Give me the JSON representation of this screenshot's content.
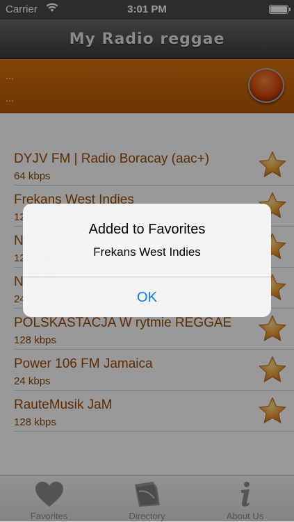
{
  "status_bar": {
    "carrier": "Carrier",
    "time": "3:01 PM"
  },
  "nav": {
    "title": "My Radio reggae"
  },
  "player": {
    "line1": "...",
    "line2": "..."
  },
  "stations": [
    {
      "name": "DYJV FM | Radio Boracay (aac+)",
      "bitrate": "64 kbps"
    },
    {
      "name": "Frekans West Indies",
      "bitrate": "128 kbps"
    },
    {
      "name": "NRJ",
      "bitrate": "128 kbps"
    },
    {
      "name": "NRJ Reggae",
      "bitrate": "24 kbps"
    },
    {
      "name": "POLSKASTACJA W rytmie REGGAE",
      "bitrate": "128 kbps"
    },
    {
      "name": "Power 106 FM Jamaica",
      "bitrate": "24 kbps"
    },
    {
      "name": "RauteMusik JaM",
      "bitrate": "128 kbps"
    }
  ],
  "tabs": [
    {
      "label": "Favorites",
      "icon": "heart-icon"
    },
    {
      "label": "Directory",
      "icon": "folder-icon"
    },
    {
      "label": "About Us",
      "icon": "info-icon"
    }
  ],
  "alert": {
    "title": "Added to Favorites",
    "message": "Frekans West Indies",
    "ok_label": "OK"
  },
  "colors": {
    "accent": "#d97410",
    "station_text": "#9c4a00",
    "alert_button": "#007aff"
  }
}
